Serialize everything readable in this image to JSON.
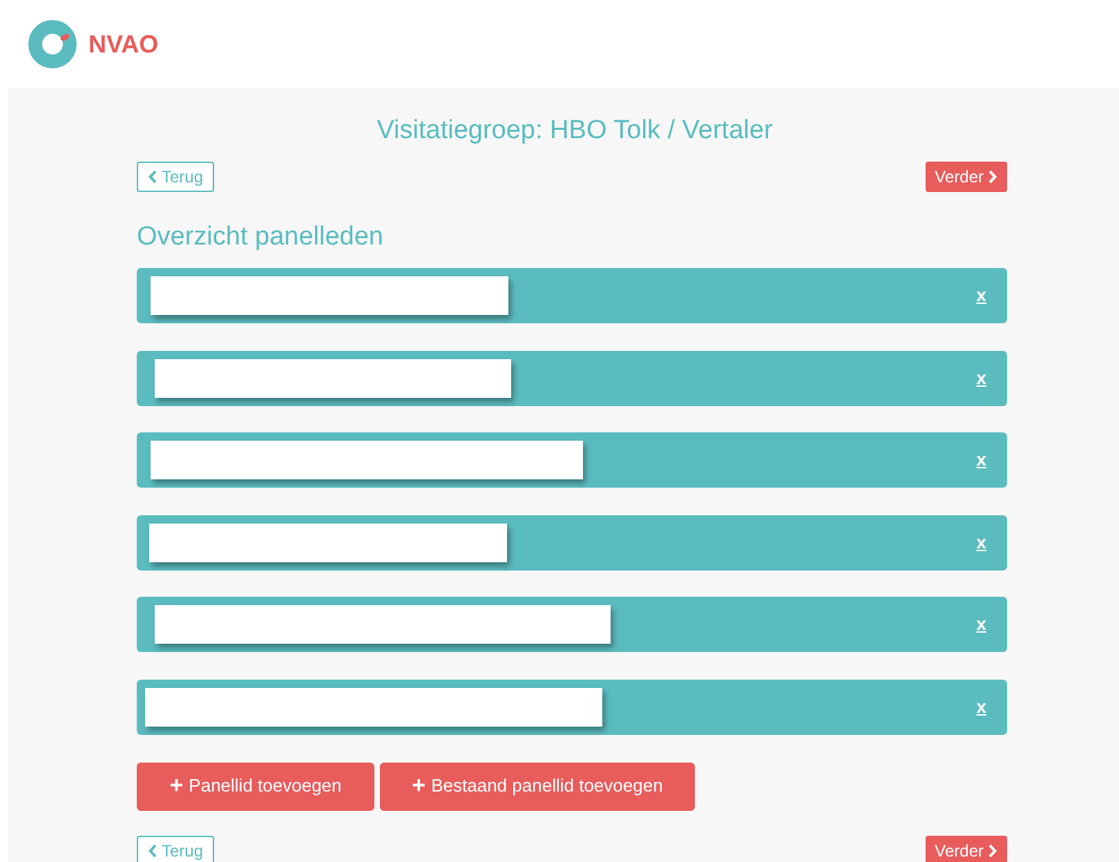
{
  "header": {
    "logo_text": "NVAO"
  },
  "title": "Visitatiegroep: HBO Tolk / Vertaler",
  "top_nav": {
    "back": "Terug",
    "next": "Verder"
  },
  "section_heading": "Overzicht panelleden",
  "panel_members": [
    {
      "remove": "x"
    },
    {
      "remove": "x"
    },
    {
      "remove": "x"
    },
    {
      "remove": "x"
    },
    {
      "remove": "x"
    },
    {
      "remove": "x"
    }
  ],
  "add_buttons": [
    {
      "icon": "+",
      "label": "Panellid toevoegen"
    },
    {
      "icon": "+",
      "label": "Bestaand panellid toevoegen"
    }
  ],
  "bottom_nav": {
    "back": "Terug",
    "next": "Verder"
  }
}
